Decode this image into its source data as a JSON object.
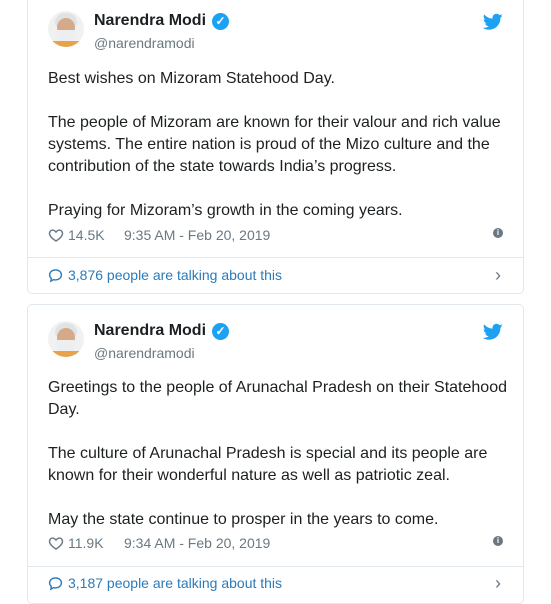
{
  "tweets": [
    {
      "author": "Narendra Modi",
      "handle": "@narendramodi",
      "paragraphs": [
        "Best wishes on Mizoram Statehood Day.",
        "The people of Mizoram are known for their valour and rich value systems. The entire nation is proud of the Mizo culture and the contribution of the state towards India’s progress.",
        "Praying for Mizoram’s growth in the coming years."
      ],
      "likes": "14.5K",
      "timestamp": "9:35 AM - Feb 20, 2019",
      "talking": "3,876 people are talking about this"
    },
    {
      "author": "Narendra Modi",
      "handle": "@narendramodi",
      "paragraphs": [
        "Greetings to the people of Arunachal Pradesh on their Statehood Day.",
        "The culture of Arunachal Pradesh is special and its people are known for their wonderful nature as well as patriotic zeal.",
        "May the state continue to prosper in the years to come."
      ],
      "likes": "11.9K",
      "timestamp": "9:34 AM - Feb 20, 2019",
      "talking": "3,187 people are talking about this"
    }
  ],
  "colors": {
    "twitter_blue": "#1da1f2",
    "link_blue": "#2b7bb9",
    "meta_gray": "#697882"
  }
}
